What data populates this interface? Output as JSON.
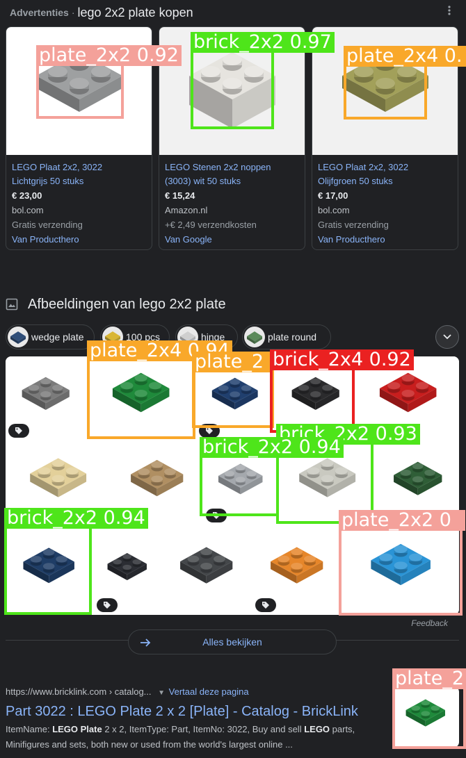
{
  "header": {
    "ads_label": "Advertenties",
    "separator": "·",
    "query": "lego 2x2 plate kopen",
    "menu_icon": "more-vert-icon"
  },
  "products": [
    {
      "title_line1": "LEGO Plaat 2x2, 3022",
      "title_line2": "Lichtgrijs 50 stuks",
      "price": "€ 23,00",
      "merchant": "bol.com",
      "shipping": "Gratis verzending",
      "by": "Van Producthero",
      "color": "#9ea0a1",
      "detection": {
        "label": "plate_2x2 0.92",
        "class": "pink"
      }
    },
    {
      "title_line1": "LEGO Stenen 2x2 noppen",
      "title_line2": "(3003) wit 50 stuks",
      "price": "€ 15,24",
      "merchant": "Amazon.nl",
      "shipping": "+€ 2,49 verzendkosten",
      "by": "Van Google",
      "color": "#e6e4df",
      "detection": {
        "label": "brick_2x2 0.97",
        "class": "green"
      }
    },
    {
      "title_line1": "LEGO Plaat 2x2, 3022",
      "title_line2": "Olijfgroen 50 stuks",
      "price": "€ 17,00",
      "merchant": "bol.com",
      "shipping": "Gratis verzending",
      "by": "Van Producthero",
      "color": "#a2a05a",
      "detection": {
        "label": "plate_2x4 0.",
        "class": "orange"
      }
    }
  ],
  "images_section": {
    "title": "Afbeeldingen van lego 2x2 plate",
    "icon": "image-icon",
    "chips": [
      {
        "label": "wedge plate",
        "color": "#2f4e79"
      },
      {
        "label": "100 pcs",
        "color": "#d9b634"
      },
      {
        "label": "hinge",
        "color": "#cfcfcf"
      },
      {
        "label": "plate round",
        "color": "#5b8a5a"
      }
    ],
    "expand_icon": "chevron-down-icon",
    "tiles": [
      {
        "color": "#7b7b7b",
        "tag": true
      },
      {
        "color": "#1f8a3b",
        "tag": false
      },
      {
        "color": "#203f6e",
        "tag": true
      },
      {
        "color": "#2b2b2d",
        "tag": false
      },
      {
        "color": "#c81e1e",
        "tag": false
      },
      {
        "color": "#e3d09a",
        "tag": false
      },
      {
        "color": "#b08f62",
        "tag": false
      },
      {
        "color": "#a4a8ad",
        "tag": true
      },
      {
        "color": "#c9c9c0",
        "tag": false
      },
      {
        "color": "#2f5e37",
        "tag": false
      },
      {
        "color": "#1f3d66",
        "tag": false
      },
      {
        "color": "#2b2d33",
        "tag": true
      },
      {
        "color": "#44474a",
        "tag": false
      },
      {
        "color": "#e6862a",
        "tag": true
      },
      {
        "color": "#2a94d6",
        "tag": false
      }
    ],
    "detections": [
      {
        "label": "plate_2x4 0.94",
        "class": "orange"
      },
      {
        "label": "plate_2",
        "class": "orange"
      },
      {
        "label": "brick_2x4 0.92",
        "class": "red"
      },
      {
        "label": "brick_2x2 0.93",
        "class": "green"
      },
      {
        "label": "brick_2x2 0.94",
        "class": "green"
      },
      {
        "label": "brick_2x2 0.94",
        "class": "green"
      },
      {
        "label": "plate_2x2 0",
        "class": "pink"
      }
    ],
    "feedback": "Feedback",
    "see_all": "Alles bekijken"
  },
  "result": {
    "url": "https://www.bricklink.com › catalog...",
    "translate": "Vertaal deze pagina",
    "title": "Part 3022 : LEGO Plate 2 x 2 [Plate] - Catalog - BrickLink",
    "snippet_parts": [
      "ItemName: ",
      "LEGO Plate",
      " 2 x 2, ItemType: Part, ItemNo: 3022, Buy and sell ",
      "LEGO",
      " parts,",
      "Minifigures and sets, both new or used from the world's largest online ..."
    ],
    "thumb_color": "#1f8a3b",
    "detection": {
      "label": "plate_2",
      "class": "pink"
    }
  }
}
